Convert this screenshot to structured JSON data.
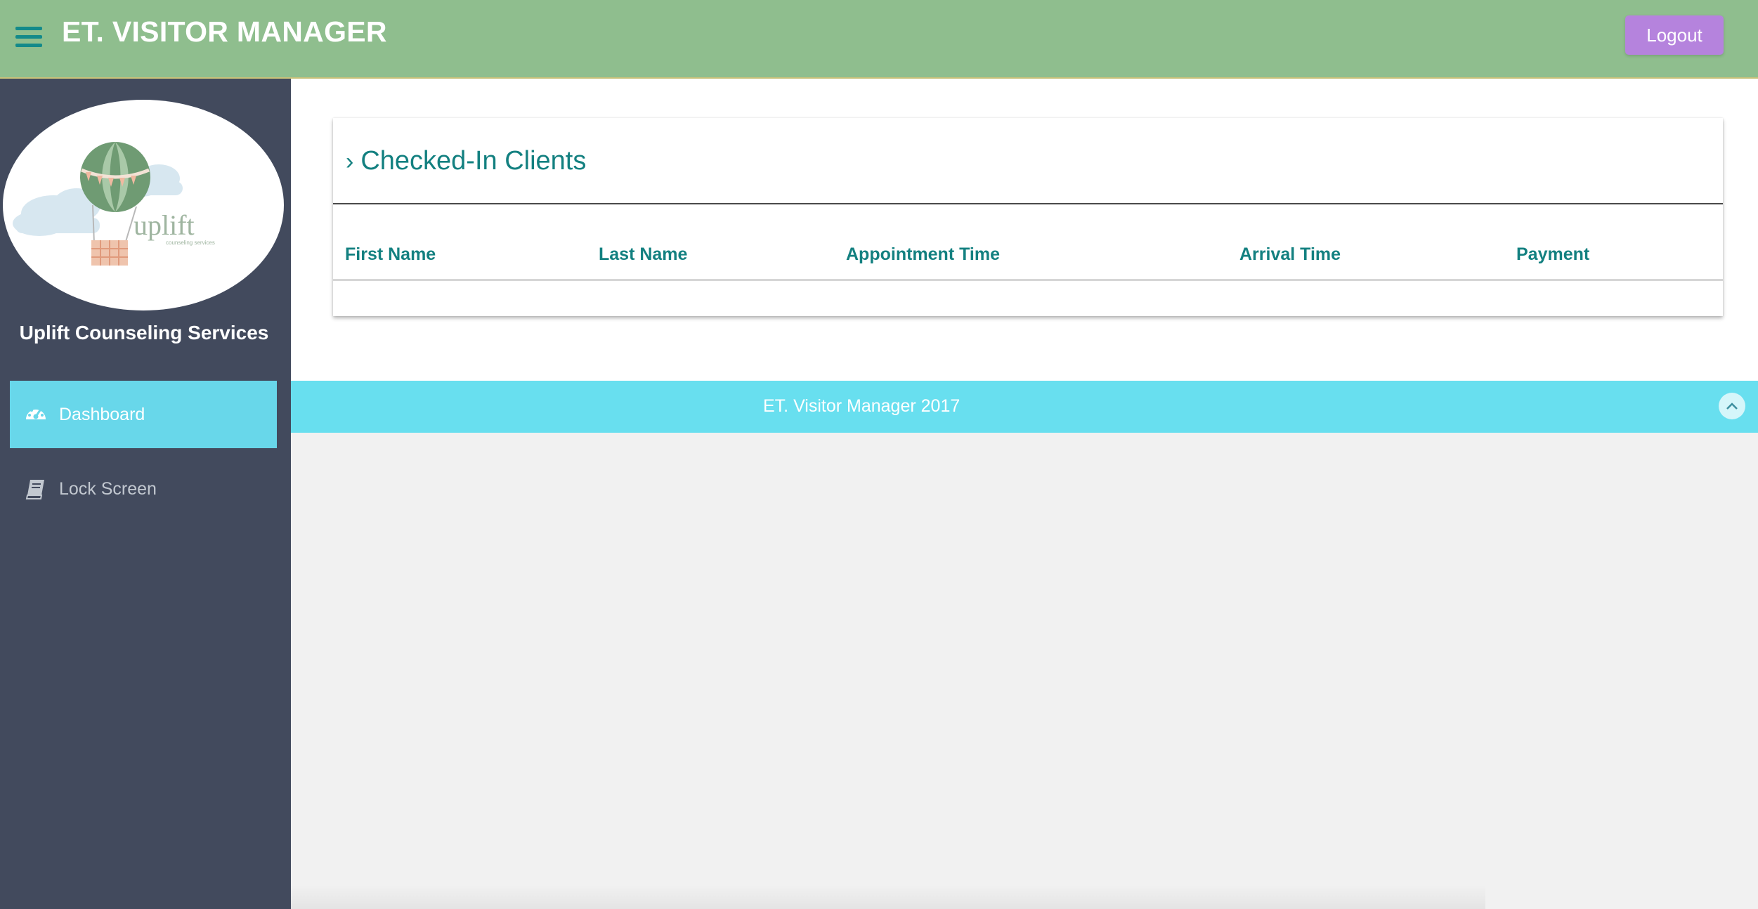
{
  "header": {
    "title": "ET. VISITOR MANAGER",
    "logout_label": "Logout",
    "menu_icon": "hamburger-menu-icon"
  },
  "sidebar": {
    "logo_text": "uplift",
    "logo_subtext": "counseling services",
    "organization": "Uplift Counseling Services",
    "items": [
      {
        "label": "Dashboard",
        "icon": "dashboard-gauge-icon",
        "active": true
      },
      {
        "label": "Lock Screen",
        "icon": "book-icon",
        "active": false
      }
    ]
  },
  "main": {
    "panel_title": "Checked-In Clients",
    "table": {
      "columns": [
        "First Name",
        "Last Name",
        "Appointment Time",
        "Arrival Time",
        "Payment"
      ],
      "rows": []
    }
  },
  "footer": {
    "text": "ET. Visitor Manager 2017",
    "scroll_icon": "chevron-up-icon"
  },
  "colors": {
    "header_bg": "#8fbe8e",
    "sidebar_bg": "#424a5d",
    "accent_cyan": "#68d7ea",
    "teal_text": "#138080",
    "logout_bg": "#b583dd"
  }
}
